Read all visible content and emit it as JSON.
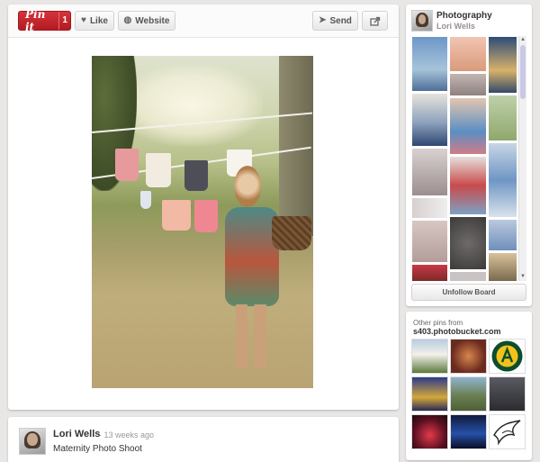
{
  "toolbar": {
    "pinit_label": "Pin it",
    "pinit_count": "1",
    "like_label": "Like",
    "website_label": "Website",
    "send_label": "Send"
  },
  "comment": {
    "author": "Lori Wells",
    "time": "· 13 weeks ago",
    "text": "Maternity Photo Shoot"
  },
  "board": {
    "title": "Photography",
    "owner": "Lori Wells",
    "unfollow_label": "Unfollow Board"
  },
  "other_pins": {
    "label": "Other pins from",
    "domain": "s403.photobucket.com"
  },
  "colors": {
    "pinit_red": "#c0232a",
    "background": "#e9e6e6"
  }
}
